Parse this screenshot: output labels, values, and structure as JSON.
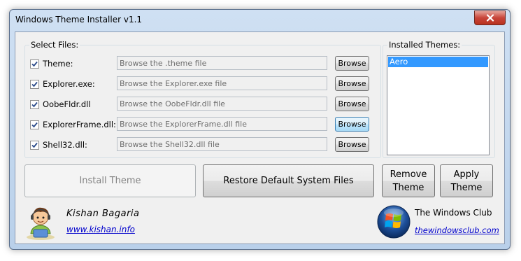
{
  "window": {
    "title": "Windows Theme Installer v1.1"
  },
  "select_files": {
    "legend": "Select Files:",
    "rows": [
      {
        "label": "Theme:",
        "placeholder": "Browse the .theme file",
        "button": "Browse",
        "checked": true
      },
      {
        "label": "Explorer.exe:",
        "placeholder": "Browse the Explorer.exe file",
        "button": "Browse",
        "checked": true
      },
      {
        "label": "OobeFldr.dll",
        "placeholder": "Browse the OobeFldr.dll file",
        "button": "Browse",
        "checked": true
      },
      {
        "label": "ExplorerFrame.dll:",
        "placeholder": "Browse the ExplorerFrame.dll file",
        "button": "Browse",
        "checked": true
      },
      {
        "label": "Shell32.dll:",
        "placeholder": "Browse the Shell32.dll file",
        "button": "Browse",
        "checked": true
      }
    ]
  },
  "installed_themes": {
    "legend": "Installed Themes:",
    "items": [
      "Aero"
    ]
  },
  "actions": {
    "install": "Install Theme",
    "restore": "Restore Default System Files",
    "remove_line1": "Remove",
    "remove_line2": "Theme",
    "apply_line1": "Apply",
    "apply_line2": "Theme"
  },
  "footer": {
    "author": "Kishan Bagaria",
    "author_link": "www.kishan.info",
    "club": "The Windows Club",
    "club_link": "thewindowsclub.com"
  },
  "icons": {
    "close": "close-icon",
    "avatar": "avatar-icon",
    "windows_logo": "windows-logo-icon"
  },
  "colors": {
    "selection": "#3399ff",
    "link": "#0000cc",
    "close": "#c8453a"
  }
}
